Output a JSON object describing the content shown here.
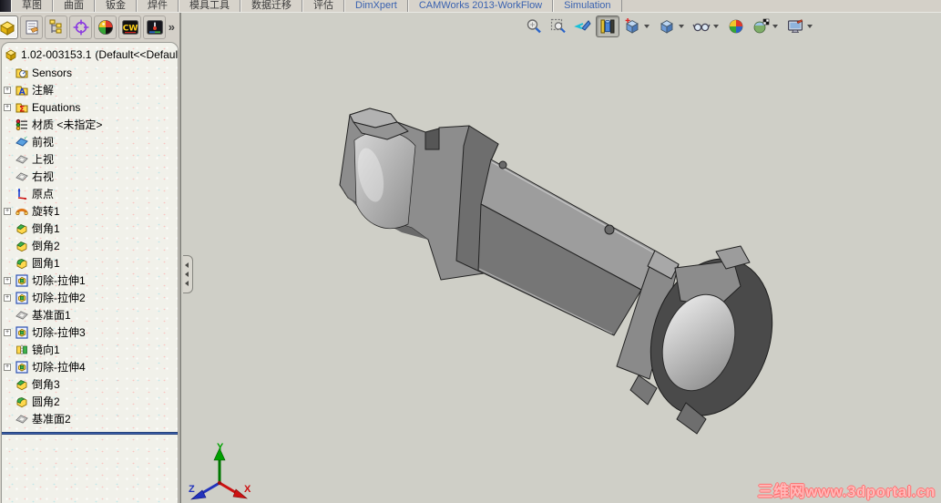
{
  "command_tabs": {
    "items": [
      {
        "label": "草图",
        "lang": "zh"
      },
      {
        "label": "曲面",
        "lang": "zh"
      },
      {
        "label": "钣金",
        "lang": "zh"
      },
      {
        "label": "焊件",
        "lang": "zh"
      },
      {
        "label": "模具工具",
        "lang": "zh"
      },
      {
        "label": "数据迁移",
        "lang": "zh"
      },
      {
        "label": "评估",
        "lang": "zh"
      },
      {
        "label": "DimXpert",
        "lang": "en"
      },
      {
        "label": "CAMWorks 2013-WorkFlow",
        "lang": "en"
      },
      {
        "label": "Simulation",
        "lang": "en"
      }
    ]
  },
  "panel_tabs": {
    "icons": [
      "featuremanager-design-tree",
      "property-manager",
      "configuration-manager",
      "dimxpert-manager",
      "display-manager",
      "camworks-tree",
      "simulation-tree"
    ],
    "more_label": "»"
  },
  "feature_tree": {
    "root": {
      "name": "1.02-003153.1",
      "config": "(Default<<Defaul"
    },
    "items": [
      {
        "label": "Sensors",
        "icon": "sensors",
        "expand": false
      },
      {
        "label": "注解",
        "icon": "annotations",
        "expand": true
      },
      {
        "label": "Equations",
        "icon": "equations",
        "expand": true
      },
      {
        "label": "材质 <未指定>",
        "icon": "material",
        "expand": false
      },
      {
        "label": "前视",
        "icon": "plane-solid",
        "expand": false
      },
      {
        "label": "上视",
        "icon": "plane",
        "expand": false
      },
      {
        "label": "右视",
        "icon": "plane",
        "expand": false
      },
      {
        "label": "原点",
        "icon": "origin",
        "expand": false
      },
      {
        "label": "旋转1",
        "icon": "revolve",
        "expand": true
      },
      {
        "label": "倒角1",
        "icon": "chamfer",
        "expand": false
      },
      {
        "label": "倒角2",
        "icon": "chamfer",
        "expand": false
      },
      {
        "label": "圆角1",
        "icon": "fillet",
        "expand": false
      },
      {
        "label": "切除-拉伸1",
        "icon": "cut-extrude",
        "expand": true
      },
      {
        "label": "切除-拉伸2",
        "icon": "cut-extrude",
        "expand": true
      },
      {
        "label": "基准面1",
        "icon": "plane",
        "expand": false
      },
      {
        "label": "切除-拉伸3",
        "icon": "cut-extrude",
        "expand": true
      },
      {
        "label": "镜向1",
        "icon": "mirror",
        "expand": false
      },
      {
        "label": "切除-拉伸4",
        "icon": "cut-extrude",
        "expand": true
      },
      {
        "label": "倒角3",
        "icon": "chamfer",
        "expand": false
      },
      {
        "label": "圆角2",
        "icon": "fillet",
        "expand": false
      },
      {
        "label": "基准面2",
        "icon": "plane",
        "expand": false
      }
    ],
    "rollback_bar": true
  },
  "headsup_toolbar": {
    "buttons": [
      {
        "name": "zoom-to-fit",
        "caret": false,
        "pressed": false
      },
      {
        "name": "zoom-to-area",
        "caret": false,
        "pressed": false
      },
      {
        "name": "previous-view",
        "caret": false,
        "pressed": false
      },
      {
        "name": "section-view",
        "caret": false,
        "pressed": true
      },
      {
        "name": "view-orientation",
        "caret": true,
        "pressed": false
      },
      {
        "name": "display-style",
        "caret": true,
        "pressed": false
      },
      {
        "name": "hide-show-items",
        "caret": true,
        "pressed": false
      },
      {
        "name": "edit-appearance",
        "caret": false,
        "pressed": false
      },
      {
        "name": "apply-scene",
        "caret": true,
        "pressed": false
      },
      {
        "name": "view-settings",
        "caret": true,
        "pressed": false
      }
    ]
  },
  "viewport": {
    "triad": {
      "x_label": "X",
      "y_label": "Y",
      "z_label": "Z"
    },
    "watermark": "三维网www.3dportal.cn",
    "model": "gray shaded half-sectioned shift-fork lever part"
  },
  "colors": {
    "chrome": "#d4d0c8",
    "viewport_bg": "#cfcfc7",
    "tree_bg": "#f1f1ea",
    "rollback_blue": "#3f63ad",
    "tab_text_blue": "#3a62b0",
    "watermark_red": "#ff6f6f",
    "triad_x": "#cc1111",
    "triad_y": "#00a000",
    "triad_z": "#2233bb"
  }
}
